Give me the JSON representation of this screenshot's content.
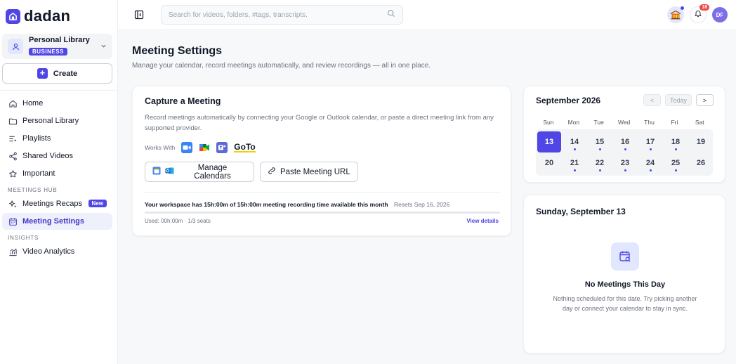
{
  "brand": {
    "name": "dadan",
    "accent": "#4f46e5"
  },
  "sidebar": {
    "library": {
      "name": "Personal Library",
      "plan": "BUSINESS"
    },
    "create_label": "Create",
    "items": [
      {
        "label": "Home"
      },
      {
        "label": "Personal Library"
      },
      {
        "label": "Playlists"
      },
      {
        "label": "Shared Videos"
      },
      {
        "label": "Important"
      }
    ],
    "sections": {
      "meetings_hub": {
        "title": "MEETINGS HUB",
        "items": [
          {
            "label": "Meetings Recaps",
            "badge": "New"
          },
          {
            "label": "Meeting Settings"
          }
        ]
      },
      "insights": {
        "title": "INSIGHTS",
        "items": [
          {
            "label": "Video Analytics"
          }
        ]
      }
    }
  },
  "topbar": {
    "search_placeholder": "Search for videos, folders, #tags, transcripts.",
    "notifications_count": "18",
    "user_initials": "DF"
  },
  "page": {
    "title": "Meeting Settings",
    "subtitle": "Manage your calendar, record meetings automatically, and review recordings — all in one place."
  },
  "capture": {
    "title": "Capture a Meeting",
    "description": "Record meetings automatically by connecting your Google or Outlook calendar, or paste a direct meeting link from any supported provider.",
    "works_with_label": "Works With",
    "providers": [
      "zoom-icon",
      "google-meet-icon",
      "teams-icon"
    ],
    "goto_label": "GoTo",
    "manage_calendars_label": "Manage Calendars",
    "paste_url_label": "Paste Meeting URL",
    "usage_text": "Your workspace has 15h:00m of 15h:00m meeting recording time available this month",
    "resets_text": "Resets Sep 16, 2026",
    "used_text": "Used: 00h:00m · 1/3 seats",
    "usage_fraction": 0,
    "view_details_label": "View details"
  },
  "calendar": {
    "month_label": "September 2026",
    "prev_label": "<",
    "today_label": "Today",
    "next_label": ">",
    "weekdays": [
      "Sun",
      "Mon",
      "Tue",
      "Wed",
      "Thu",
      "Fri",
      "Sat"
    ],
    "days": [
      {
        "d": "13",
        "selected": true,
        "dot": false
      },
      {
        "d": "14",
        "selected": false,
        "dot": true
      },
      {
        "d": "15",
        "selected": false,
        "dot": true
      },
      {
        "d": "16",
        "selected": false,
        "dot": true
      },
      {
        "d": "17",
        "selected": false,
        "dot": true
      },
      {
        "d": "18",
        "selected": false,
        "dot": true
      },
      {
        "d": "19",
        "selected": false,
        "dot": false
      },
      {
        "d": "20",
        "selected": false,
        "dot": false
      },
      {
        "d": "21",
        "selected": false,
        "dot": true
      },
      {
        "d": "22",
        "selected": false,
        "dot": true
      },
      {
        "d": "23",
        "selected": false,
        "dot": true
      },
      {
        "d": "24",
        "selected": false,
        "dot": true
      },
      {
        "d": "25",
        "selected": false,
        "dot": true
      },
      {
        "d": "26",
        "selected": false,
        "dot": false
      }
    ]
  },
  "day_panel": {
    "title": "Sunday, September 13",
    "empty_title": "No Meetings This Day",
    "empty_desc": "Nothing scheduled for this date. Try picking another day or connect your calendar to stay in sync."
  }
}
